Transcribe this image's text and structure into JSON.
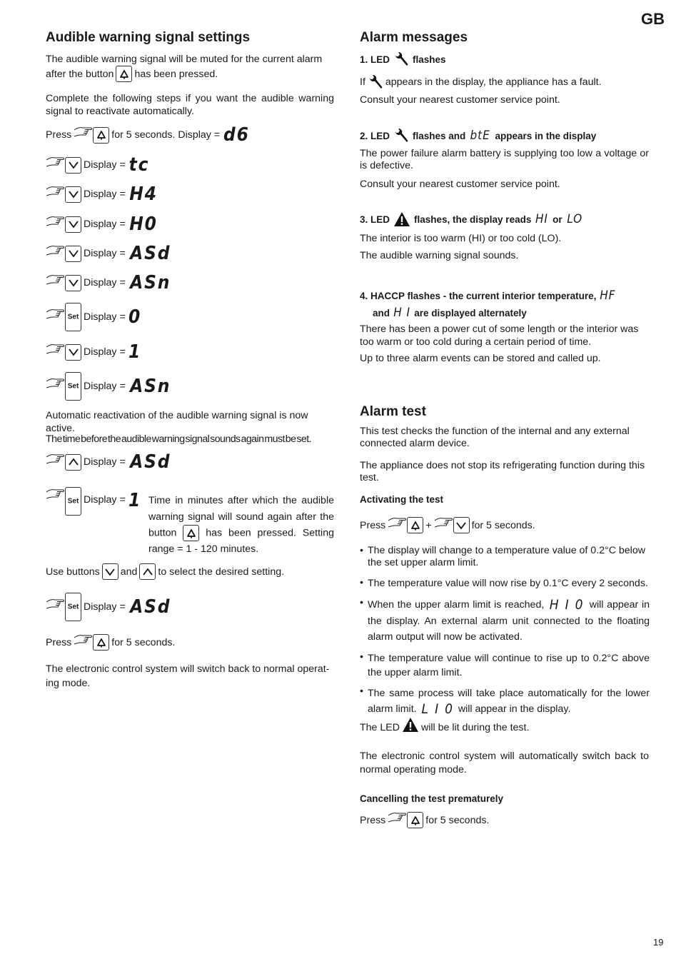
{
  "page": {
    "language_badge": "GB",
    "page_number": "19"
  },
  "icons": {
    "bell": "bell-button-icon",
    "down": "chevron-down-button-icon",
    "up": "chevron-up-button-icon",
    "set": "set-button-icon",
    "hand": "pointing-hand-icon",
    "wrench": "wrench-icon",
    "warning": "warning-triangle-icon"
  },
  "left": {
    "title": "Audible warning signal settings",
    "intro_line1": "The audible warning signal will be muted for the current alarm",
    "intro_line2_a": "after the button",
    "intro_line2_b": "has been pressed.",
    "steps_intro": "Complete the following steps if you want the audible warning signal to reactivate automatically.",
    "press_label": "Press",
    "press_suffix": "for 5 seconds. Display =",
    "press_display": "d6",
    "set_key_label": "Set",
    "display_label": "Display =",
    "steps": [
      {
        "button": "down",
        "display": "tc"
      },
      {
        "button": "down",
        "display": "H4"
      },
      {
        "button": "down",
        "display": "H0"
      },
      {
        "button": "down",
        "display": "ASd"
      },
      {
        "button": "down",
        "display": "ASn"
      },
      {
        "button": "set",
        "display": "0"
      },
      {
        "button": "down",
        "display": "1"
      },
      {
        "button": "set",
        "display": "ASn"
      }
    ],
    "auto_active": "Automatic reactivation of the audible warning signal is now active.",
    "time_must_set": "The time before the audible warning signal sounds again must be set.",
    "step_up": {
      "button": "up",
      "display": "ASd"
    },
    "step_set": {
      "button": "set",
      "display": "1"
    },
    "time_desc_a": "Time in minutes after which the audible warning signal will sound again after the button",
    "time_desc_b": "has been pressed. Setting range = 1 - 120 minutes.",
    "use_buttons_a": "Use buttons",
    "use_buttons_and": "and",
    "use_buttons_b": "to select the desired setting.",
    "step_final": {
      "button": "set",
      "display": "ASd"
    },
    "press_final_a": "Press",
    "press_final_b": "for 5 seconds.",
    "back_normal": "The electronic control system will switch back to normal operat-ing mode."
  },
  "right": {
    "title": "Alarm messages",
    "m1": {
      "head_a": "1. LED",
      "head_b": "flashes",
      "text1_a": "If",
      "text1_b": "appears in the display, the appliance has a fault.",
      "text2": "Consult your nearest customer service point."
    },
    "m2": {
      "head_a": "2. LED",
      "head_b": "flashes and",
      "head_display": "btE",
      "head_c": "appears in the display",
      "text1": "The power failure alarm battery is supplying too low a voltage or is defective.",
      "text2": "Consult your nearest customer service point."
    },
    "m3": {
      "head_a": "3. LED",
      "head_b": "flashes, the display reads",
      "head_display1": "HI",
      "head_or": "or",
      "head_display2": "LO",
      "text1": "The interior is too warm (HI) or too cold (LO).",
      "text2": "The audible warning signal sounds."
    },
    "m4": {
      "head_a": "4. HACCP flashes - the current interior temperature,",
      "head_display1": "HF",
      "head_and": "and",
      "head_display2": "H I",
      "head_b": "are displayed alternately",
      "text1": "There has been a power cut of some length or the interior was too warm or too cold during a certain period of time.",
      "text2": "Up to three alarm events can be stored and called up."
    },
    "test": {
      "title": "Alarm test",
      "p1": "This test checks the function of the internal and any external connected alarm device.",
      "p2": "The appliance does not stop its refrigerating function during this test.",
      "activating_title": "Activating the test",
      "press_a": "Press",
      "plus": "+",
      "press_b": "for 5 seconds.",
      "bullets": [
        {
          "text": "The display will change to a temperature value of 0.2°C below the set upper alarm limit."
        },
        {
          "text": "The temperature value will now rise by 0.1°C every 2 seconds."
        },
        {
          "text_a": "When the upper alarm limit is reached,",
          "display": "H I 0",
          "text_b": "will appear in the display. An external alarm unit connected to the floating alarm output will now be activated."
        },
        {
          "text": "The temperature value will continue to rise up to 0.2°C above the upper alarm limit."
        },
        {
          "text_a": "The same process will take place automatically for the lower alarm limit.",
          "display": "L I 0",
          "text_b": "will appear in the display."
        }
      ],
      "led_a": "The LED",
      "led_b": "will be lit during the test.",
      "auto_back": "The electronic control system will automatically switch back to normal operating mode.",
      "cancel_title": "Cancelling the test prematurely",
      "cancel_a": "Press",
      "cancel_b": "for 5 seconds."
    }
  }
}
